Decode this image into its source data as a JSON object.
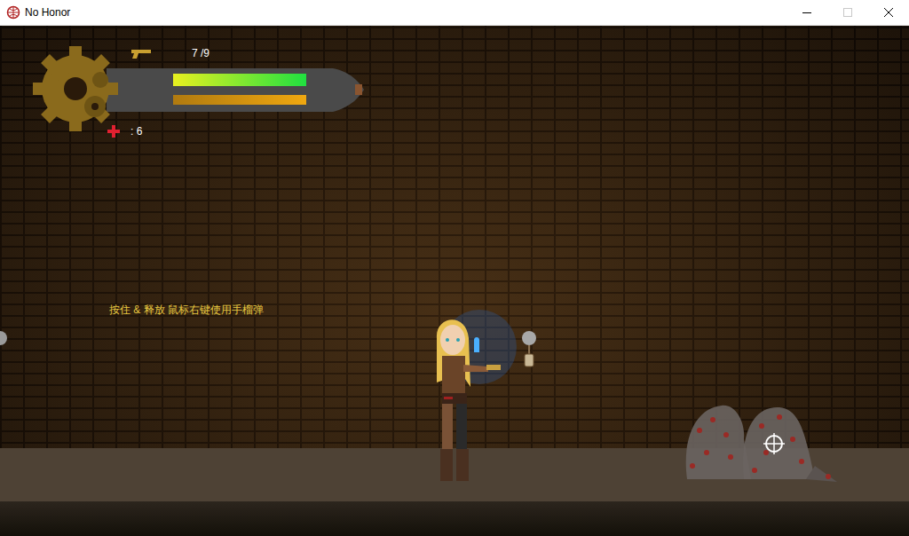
{
  "window": {
    "title": "No Honor"
  },
  "hud": {
    "ammo": "7 /9",
    "health": {
      "level": 1.0
    },
    "stamina": {
      "level": 1.0
    },
    "medkits": ": 6"
  },
  "hint": "按住 & 释放 鼠标右键使用手榴弹"
}
